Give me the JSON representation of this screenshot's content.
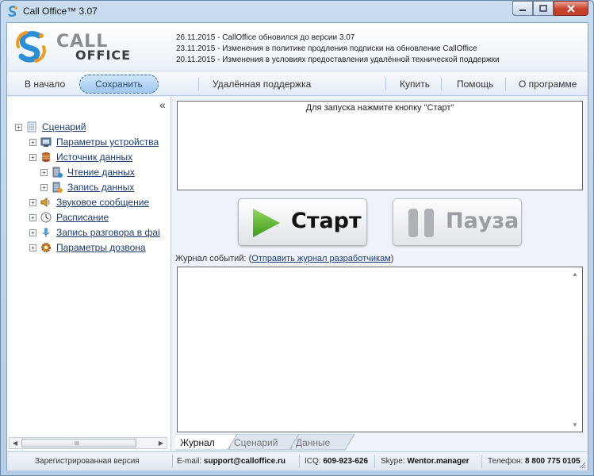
{
  "window": {
    "title": "Call Office™ 3.07"
  },
  "header": {
    "logo_top": "CALL",
    "logo_bottom": "OFFICE",
    "news": [
      "26.11.2015 - CallOffice обновился до версии 3.07",
      "23.11.2015 - Изменения в политике продления подписки на обновление CallOffice",
      "20.11.2015 - Изменения в условиях предоставления удалённой технической поддержки"
    ]
  },
  "nav": {
    "home": "В начало",
    "save": "Сохранить",
    "remote_support": "Удалённая поддержка",
    "buy": "Купить",
    "help": "Помощь",
    "about": "О программе"
  },
  "tree": {
    "collapse_glyph": "«",
    "items": [
      {
        "label": "Сценарий",
        "icon": "scenario-icon"
      },
      {
        "label": "Параметры устройства",
        "icon": "device-icon"
      },
      {
        "label": "Источник данных",
        "icon": "database-icon"
      },
      {
        "label": "Чтение данных",
        "icon": "data-read-icon"
      },
      {
        "label": "Запись данных",
        "icon": "data-write-icon"
      },
      {
        "label": "Звуковое сообщение",
        "icon": "speaker-icon"
      },
      {
        "label": "Расписание",
        "icon": "clock-icon"
      },
      {
        "label": "Запись разговора в фаі",
        "icon": "microphone-icon"
      },
      {
        "label": "Параметры дозвона",
        "icon": "gear-icon"
      }
    ],
    "scroll_grip": "III"
  },
  "main": {
    "hint": "Для запуска нажмите кнопку \"Старт\"",
    "start": "Старт",
    "pause": "Пауза",
    "log_label": "Журнал событий: ",
    "log_link": "Отправить журнал разработчикам",
    "tabs": [
      "Журнал",
      "Сценарий",
      "Данные"
    ]
  },
  "status": {
    "registered": "Зарегистрированная версия",
    "email_label": "E-mail:",
    "email": "support@calloffice.ru",
    "icq_label": "ICQ:",
    "icq": "609-923-626",
    "skype_label": "Skype:",
    "skype": "Wentor.manager",
    "phone_label": "Телефон:",
    "phone": "8 800 775 0105"
  },
  "colors": {
    "accent_orange": "#f29a1f",
    "accent_blue": "#2a8fd6",
    "play_green": "#58b52e"
  }
}
